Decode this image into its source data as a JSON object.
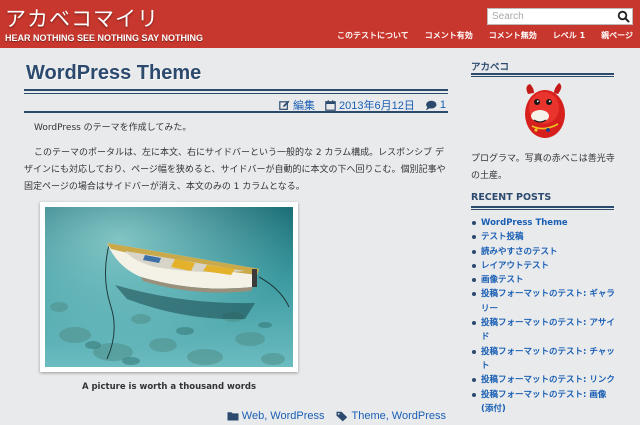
{
  "header": {
    "site_title": "アカベコマイリ",
    "tagline": "HEAR NOTHING SEE NOTHING SAY NOTHING",
    "search_placeholder": "Search",
    "nav": [
      "このテストについて",
      "コメント有効",
      "コメント無効",
      "レベル 1",
      "親ページ"
    ]
  },
  "post": {
    "title": "WordPress Theme",
    "edit_label": "編集",
    "date": "2013年6月12日",
    "comment_count": "1",
    "paragraph1": "WordPress のテーマを作成してみた。",
    "paragraph2": "このテーマのポータルは、左に本文、右にサイドバーという一般的な 2 カラム構成。レスポンシブ デザインにも対応しており、ページ幅を狭めると、サイドバーが自動的に本文の下へ回りこむ。個別記事や固定ページの場合はサイドバーが消え、本文のみの 1 カラムとなる。",
    "caption": "A picture is worth a thousand words",
    "categories": [
      "Web",
      "WordPress"
    ],
    "tags": [
      "Theme",
      "WordPress"
    ]
  },
  "sidebar": {
    "profile_title": "アカベコ",
    "profile_text": "プログラマ。写真の赤べこは善光寺の土産。",
    "recent_title": "RECENT POSTS",
    "recent_posts": [
      "WordPress Theme",
      "テスト投稿",
      "読みやすさのテスト",
      "レイアウトテスト",
      "画像テスト",
      "投稿フォーマットのテスト: ギャラリー",
      "投稿フォーマットのテスト: アサイド",
      "投稿フォーマットのテスト: チャット",
      "投稿フォーマットのテスト: リンク",
      "投稿フォーマットのテスト: 画像 (添付)"
    ]
  },
  "colors": {
    "header_bg": "#c8372d",
    "accent": "#2c4a6e",
    "link": "#1a5fb4",
    "page_bg": "#e9eaec"
  },
  "icons": [
    "search-icon",
    "edit-icon",
    "calendar-icon",
    "comment-icon",
    "folder-icon",
    "tag-icon"
  ]
}
